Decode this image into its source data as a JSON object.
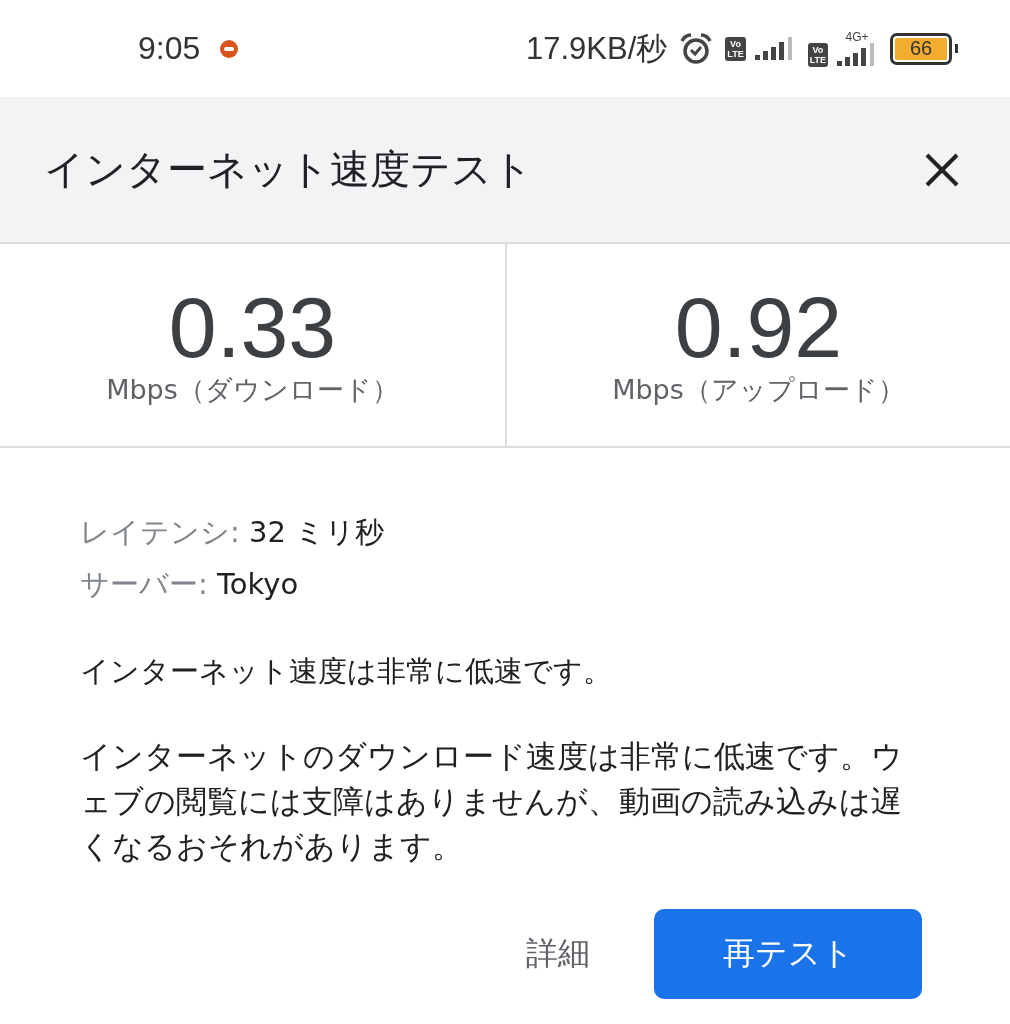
{
  "status_bar": {
    "time": "9:05",
    "net_speed": "17.9KB/秒",
    "sim_badges": [
      {
        "top": "Vo",
        "bottom": "LTE"
      },
      {
        "top": "Vo",
        "bottom": "LTE",
        "network": "4G+"
      }
    ],
    "battery": "66"
  },
  "header": {
    "title": "インターネット速度テスト"
  },
  "results": [
    {
      "value": "0.33",
      "unit": "Mbps（ダウンロード）"
    },
    {
      "value": "0.92",
      "unit": "Mbps（アップロード）"
    }
  ],
  "details": [
    {
      "label": "レイテンシ:",
      "value": "32 ミリ秒"
    },
    {
      "label": "サーバー:",
      "value": "Tokyo"
    }
  ],
  "summary": "インターネット速度は非常に低速です。",
  "description": "インターネットのダウンロード速度は非常に低速です。ウェブの閲覧には支障はありませんが、動画の読み込みは遅くなるおそれがあります。",
  "buttons": {
    "details": "詳細",
    "retest": "再テスト"
  }
}
